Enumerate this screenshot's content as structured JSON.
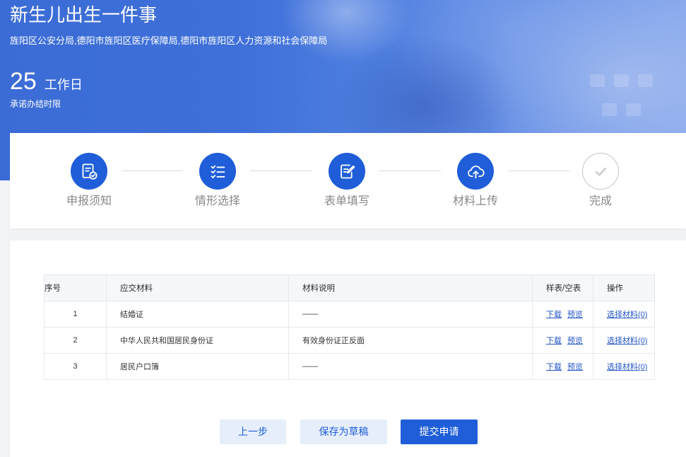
{
  "header": {
    "title": "新生儿出生一件事",
    "departments": "旌阳区公安分局,德阳市旌阳区医疗保障局,德阳市旌阳区人力资源和社会保障局",
    "time_limit_value": "25",
    "time_limit_unit": "工作日",
    "time_limit_label": "承诺办结时限"
  },
  "steps": [
    {
      "label": "申报须知",
      "icon": "notice-check-icon",
      "highlighted": true
    },
    {
      "label": "情形选择",
      "icon": "checklist-icon",
      "highlighted": true
    },
    {
      "label": "表单填写",
      "icon": "form-edit-icon",
      "highlighted": true
    },
    {
      "label": "材料上传",
      "icon": "cloud-upload-icon",
      "highlighted": true
    },
    {
      "label": "完成",
      "icon": "check-icon",
      "highlighted": false
    }
  ],
  "materials_table": {
    "columns": [
      "序号",
      "应交材料",
      "材料说明",
      "样表/空表",
      "操作"
    ],
    "rows": [
      {
        "index": "1",
        "name": "结婚证",
        "description": "——",
        "download_label": "下载",
        "preview_label": "预览",
        "action_label": "选择材料(0)"
      },
      {
        "index": "2",
        "name": "中华人民共和国居民身份证",
        "description": "有效身份证正反面",
        "download_label": "下载",
        "preview_label": "预览",
        "action_label": "选择材料(0)"
      },
      {
        "index": "3",
        "name": "居民户口簿",
        "description": "——",
        "download_label": "下载",
        "preview_label": "预览",
        "action_label": "选择材料(0)"
      }
    ]
  },
  "actions": {
    "prev_label": "上一步",
    "save_draft_label": "保存为草稿",
    "submit_label": "提交申请"
  },
  "colors": {
    "primary": "#1f5ed8",
    "banner": "#3b6cd6",
    "secondary_button_bg": "#e6eefb",
    "link": "#2356c4",
    "inactive_step": "#c6c6c6",
    "step_label": "#888888"
  }
}
